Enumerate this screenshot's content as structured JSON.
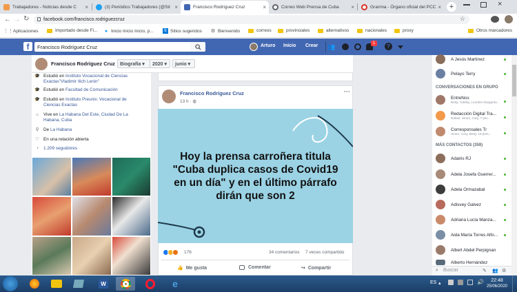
{
  "tabs": [
    {
      "title": "Trabajadores - Noticias desde C",
      "color": "#f2994a"
    },
    {
      "title": "(3) Periódico Trabajadores (@Sit",
      "color": "#1da1f2"
    },
    {
      "title": "Francisco Rodríguez Cruz",
      "color": "#4267b2"
    },
    {
      "title": "Correo Web Prensa de Cuba",
      "color": "#5f6368"
    },
    {
      "title": "Granma - Órgano oficial del PCC",
      "color": "#d93025"
    }
  ],
  "url": "facebook.com/francisco.rodriguezcruz",
  "bookmarks": [
    "Aplicaciones",
    "Importado desde Fi...",
    "Inicio Inicio Inicio, p...",
    "Sitios sugeridos",
    "Bienvenido",
    "correos",
    "provinciales",
    "alternativos",
    "nacionales",
    "proxy",
    "Otros marcadores"
  ],
  "fb": {
    "search_value": "Francisco Rodríguez Cruz",
    "user": "Arturo",
    "home": "Inicio",
    "create": "Crear",
    "notif_count": "1"
  },
  "profile": {
    "name": "Francisco Rodríguez Cruz",
    "section": "Biografía",
    "year": "2020",
    "month": "junio"
  },
  "intro": [
    {
      "pre": "Estudió en ",
      "link": "Instituto Vocacional de Ciencias Exactas\"Vladimir Ilich Lenin\"",
      "post": ""
    },
    {
      "pre": "Estudió en ",
      "link": "Facultad de Comunicación",
      "post": ""
    },
    {
      "pre": "Estudió en ",
      "link": "Instituto Preuniv. Vocacional de Ciencias Exactas",
      "post": ""
    },
    {
      "pre": "Vive en ",
      "link": "La Habana Del Este, Ciudad De La Habana, Cuba",
      "post": ""
    },
    {
      "pre": "De ",
      "link": "La Habana",
      "post": ""
    },
    {
      "pre": "En una relación abierta",
      "link": "",
      "post": ""
    },
    {
      "pre": "1.209 seguidores",
      "link": "",
      "post": ""
    }
  ],
  "post": {
    "author": "Francisco Rodríguez Cruz",
    "time": "13 h",
    "image_text": "Hoy la prensa carroñera titula \"Cuba duplica casos de Covid19 en un día\" y en el último párrafo dirán que son 2",
    "reactions": "176",
    "comments": "34 comentarios",
    "shares": "7 veces compartido",
    "like": "Me gusta",
    "comment": "Comentar",
    "share": "Compartir"
  },
  "contacts_top": [
    {
      "name": "A Jesús Martínez",
      "color": "#8a6d5b"
    },
    {
      "name": "Pelayo Terry",
      "color": "#6b7fa3"
    }
  ],
  "groups_title": "CONVERSACIONES EN GRUPO",
  "groups": [
    {
      "name": "EntreNos",
      "members": "Betty, Yulelky, Lourdes Margarita...",
      "color": "#a0786a"
    },
    {
      "name": "Redacción Digital Tra...",
      "members": "Rafael, Hiram, Cary, T par...",
      "color": "#f2994a"
    },
    {
      "name": "Corresponsales Tr",
      "members": "Hiram, Cary, Betty, 19 pers...",
      "color": "#c08a6e"
    }
  ],
  "more_title": "MÁS CONTACTOS (359)",
  "contacts": [
    {
      "name": "Adairis RJ",
      "color": "#8c6e5a"
    },
    {
      "name": "Adela Josefa Guerrer...",
      "color": "#a88a78"
    },
    {
      "name": "Adela Ormazabal",
      "color": "#3d3d3d"
    },
    {
      "name": "Adisvey Galvez",
      "color": "#b86a5c"
    },
    {
      "name": "Adriana Lucía Manza...",
      "color": "#c98a6a"
    },
    {
      "name": "Aida María Torres Alfo...",
      "color": "#7a8fa6"
    },
    {
      "name": "Albert Abdel Perpignan",
      "color": "#9a7a6a"
    },
    {
      "name": "Alberto Hernández",
      "color": "#5a6a7a"
    }
  ],
  "chat_search": "Buscar",
  "system": {
    "lang": "ES",
    "time": "22:48",
    "date": "25/06/2020"
  }
}
